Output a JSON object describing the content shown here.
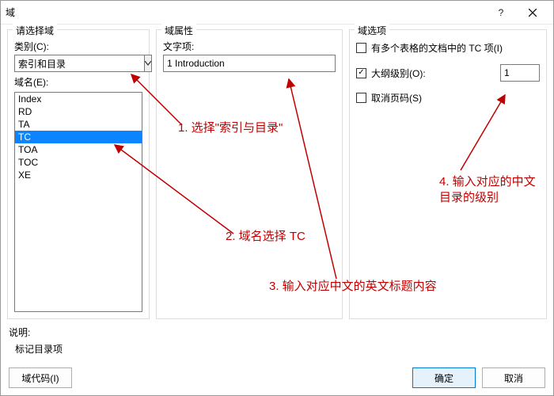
{
  "titlebar": {
    "title": "域"
  },
  "left": {
    "group_title": "请选择域",
    "category_label": "类别(C):",
    "category_value": "索引和目录",
    "fieldname_label": "域名(E):",
    "items": [
      "Index",
      "RD",
      "TA",
      "TC",
      "TOA",
      "TOC",
      "XE"
    ],
    "selected": "TC"
  },
  "mid": {
    "group_title": "域属性",
    "textitem_label": "文字项:",
    "textitem_value": "1 Introduction"
  },
  "right": {
    "group_title": "域选项",
    "opt_multi": "有多个表格的文档中的 TC 项(I)",
    "opt_outline": "大纲级别(O):",
    "opt_nopage": "取消页码(S)",
    "outline_checked": true,
    "outline_value": "1"
  },
  "desc": {
    "label": "说明:",
    "value": "标记目录项"
  },
  "footer": {
    "codes": "域代码(I)",
    "ok": "确定",
    "cancel": "取消"
  },
  "annotations": {
    "a1": "1. 选择\"索引与目录\"",
    "a2": "2. 域名选择 TC",
    "a3": "3. 输入对应中文的英文标题内容",
    "a4a": "4. 输入对应的中文",
    "a4b": "目录的级别"
  }
}
